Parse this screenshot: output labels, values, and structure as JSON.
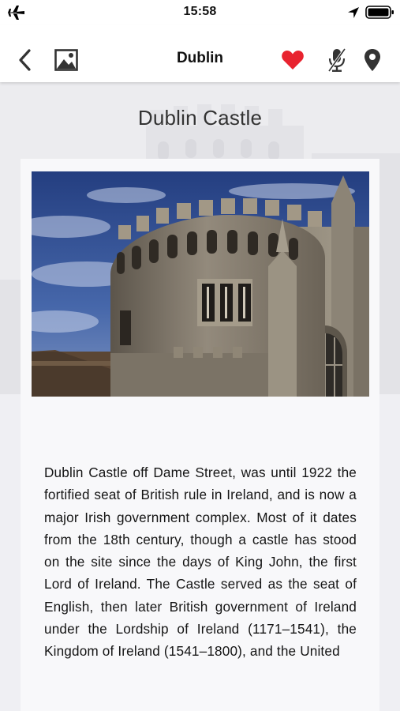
{
  "status_bar": {
    "time": "15:58"
  },
  "nav": {
    "title": "Dublin",
    "icons": [
      "back-chevron-icon",
      "gallery-icon",
      "heart-icon",
      "microphone-icon",
      "map-pin-icon"
    ],
    "favorite_color": "#e8232f"
  },
  "page": {
    "title": "Dublin Castle",
    "description": "Dublin Castle off Dame Street, was until 1922 the fortified seat of British rule in Ireland, and is now a major Irish government complex. Most of it dates from the 18th century, though a castle has stood on the site since the days of King John, the first Lord of Ireland. The Castle served as the seat of English, then later British government of Ireland under the Lordship of Ireland (1171–1541), the Kingdom of Ireland (1541–1800), and the United"
  }
}
